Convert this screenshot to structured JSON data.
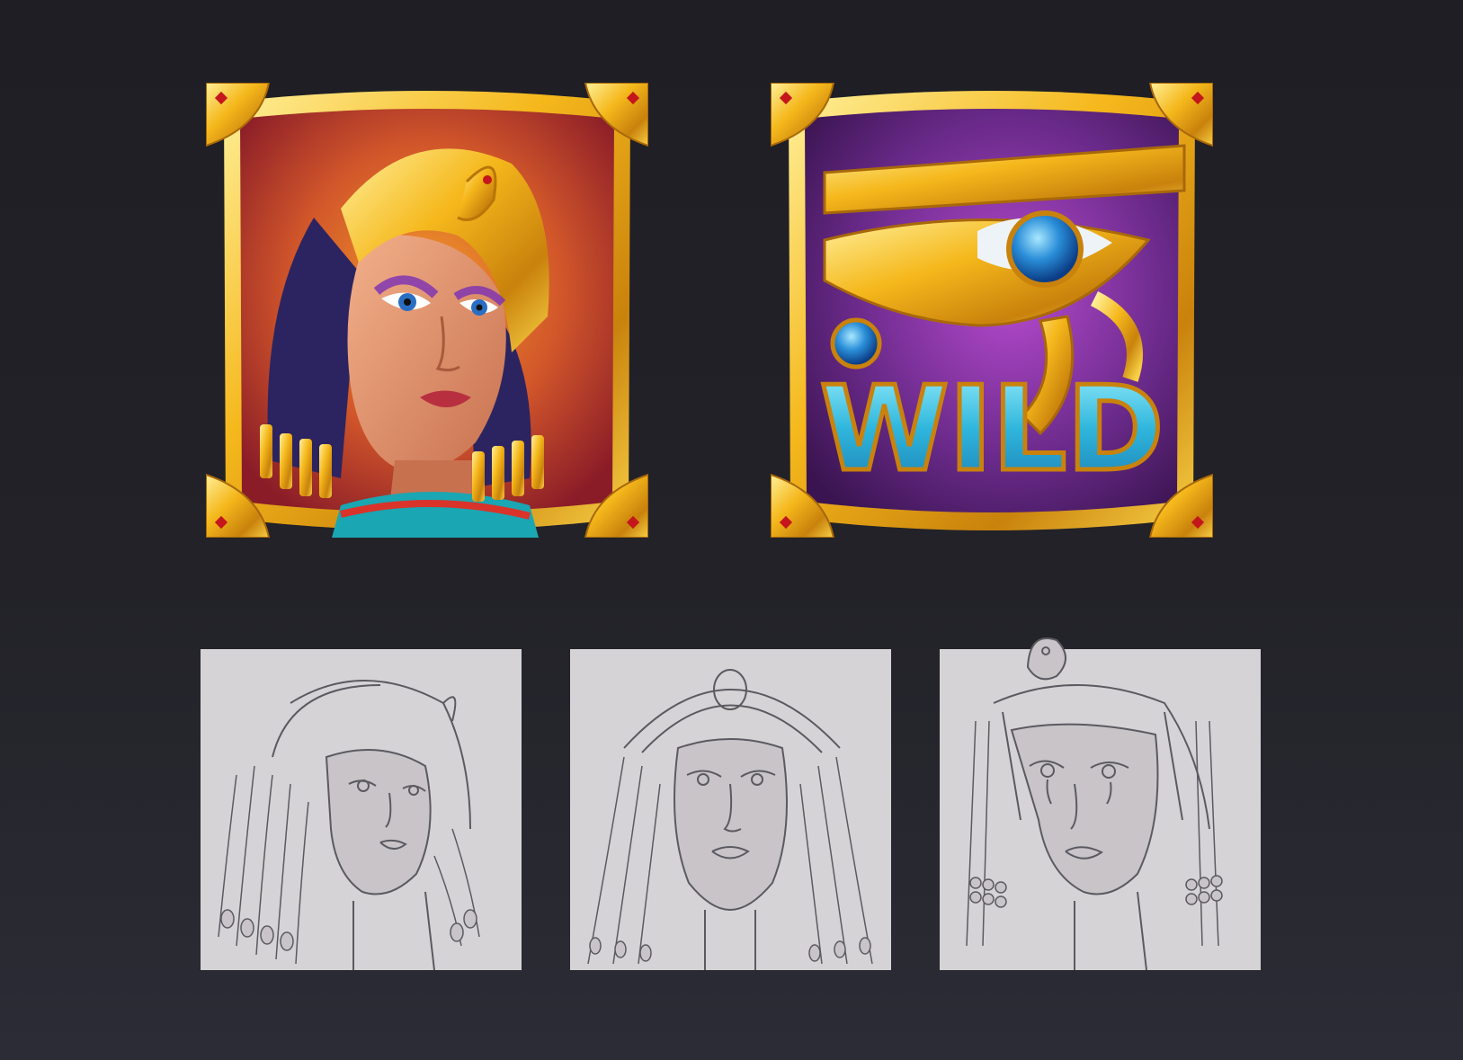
{
  "symbols": [
    {
      "id": "queen",
      "label": ""
    },
    {
      "id": "wild",
      "label": "WILD"
    }
  ],
  "sketches": [
    {
      "id": "sketch-1"
    },
    {
      "id": "sketch-2"
    },
    {
      "id": "sketch-3"
    }
  ],
  "colors": {
    "background": "#1f1f25",
    "gold": "#f3b619",
    "gold_dark": "#b8760a",
    "queen_bg": "#b43a25",
    "wild_bg": "#6a2a8a",
    "wild_text": "#3cc6e6",
    "eye_gem": "#2a8ed8",
    "sketch_bg": "#d6d3d6",
    "sketch_line": "#5a5a60"
  },
  "icons": [
    "cleopatra-portrait",
    "eye-of-horus-icon",
    "blue-gem-icon",
    "lotus-corner-icon"
  ]
}
